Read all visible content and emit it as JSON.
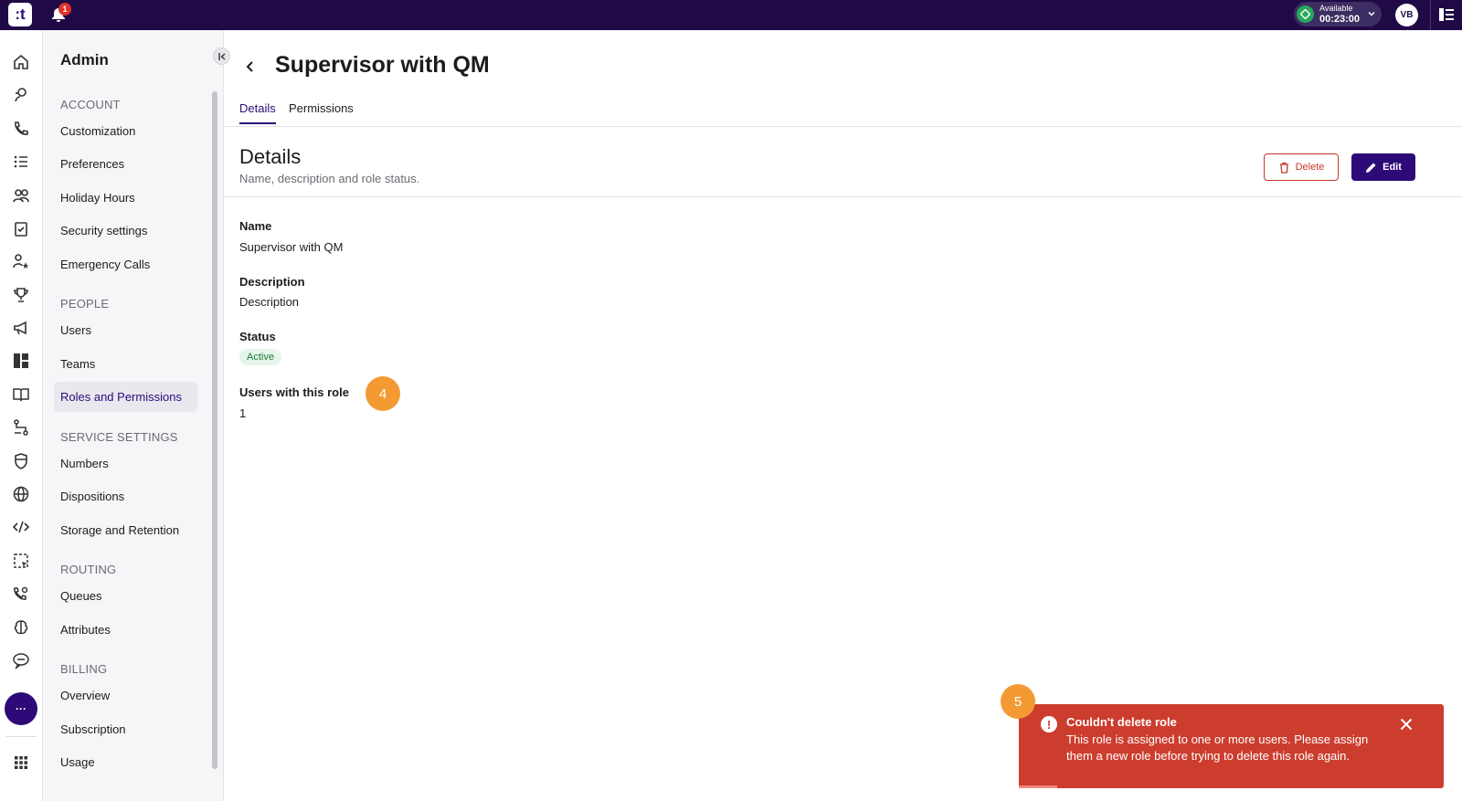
{
  "topbar": {
    "logo_text": ":t",
    "notification_count": "1",
    "status_label": "Available",
    "status_time": "00:23:00",
    "avatar_initials": "VB",
    "colors": {
      "bar": "#1f0a45",
      "available": "#27a85a",
      "badge": "#e0312b"
    }
  },
  "rail": {
    "icons": [
      "home-icon",
      "agent-icon",
      "phone-icon",
      "list-icon",
      "people-icon",
      "clipboard-icon",
      "user-star-icon",
      "trophy-icon",
      "megaphone-icon",
      "dashboard-icon",
      "book-icon",
      "flow-icon",
      "shield-icon",
      "globe-icon",
      "code-icon",
      "screen-select-icon",
      "phone-settings-icon",
      "brain-icon",
      "chat-icon"
    ],
    "more_label": "···",
    "apps_icon": "grid-icon"
  },
  "sidebar": {
    "title": "Admin",
    "sections": [
      {
        "heading": "ACCOUNT",
        "items": [
          "Customization",
          "Preferences",
          "Holiday Hours",
          "Security settings",
          "Emergency Calls"
        ]
      },
      {
        "heading": "PEOPLE",
        "items": [
          "Users",
          "Teams",
          "Roles and Permissions"
        ]
      },
      {
        "heading": "SERVICE SETTINGS",
        "items": [
          "Numbers",
          "Dispositions",
          "Storage and Retention"
        ]
      },
      {
        "heading": "ROUTING",
        "items": [
          "Queues",
          "Attributes"
        ]
      },
      {
        "heading": "BILLING",
        "items": [
          "Overview",
          "Subscription",
          "Usage"
        ]
      }
    ],
    "active_item": "Roles and Permissions"
  },
  "main": {
    "page_title": "Supervisor with QM",
    "tabs": [
      {
        "label": "Details",
        "active": true
      },
      {
        "label": "Permissions",
        "active": false
      }
    ],
    "section_title": "Details",
    "section_subtitle": "Name, description and role status.",
    "delete_label": "Delete",
    "edit_label": "Edit",
    "fields": {
      "name_label": "Name",
      "name_value": "Supervisor with QM",
      "description_label": "Description",
      "description_value": "Description",
      "status_label": "Status",
      "status_value": "Active",
      "users_label": "Users with this role",
      "users_value": "1"
    },
    "step_markers": [
      "4",
      "5"
    ],
    "accent_color": "#2d0a78",
    "danger_color": "#c8372a"
  },
  "toast": {
    "title": "Couldn't delete role",
    "message": "This role is assigned to one or more users. Please assign them a new role before trying to delete this role again.",
    "progress": 0.09,
    "color": "#cc3d2e"
  }
}
